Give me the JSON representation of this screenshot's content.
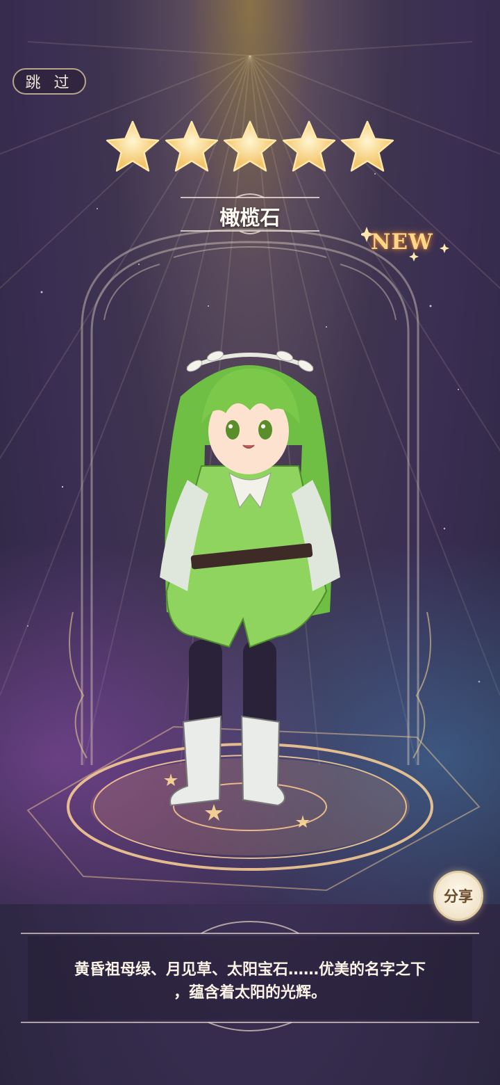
{
  "header": {
    "skip_label": "跳 过"
  },
  "rating": {
    "stars": 5
  },
  "character": {
    "name": "橄榄石",
    "badge": "NEW"
  },
  "actions": {
    "share_label": "分享"
  },
  "description": {
    "line1": "黄昏祖母绿、月见草、太阳宝石……优美的名字之下",
    "line2": "，蕴含着太阳的光辉。"
  },
  "colors": {
    "accent": "#e9c98a",
    "hair": "#7cc84a",
    "badge": "#ffd78a"
  }
}
